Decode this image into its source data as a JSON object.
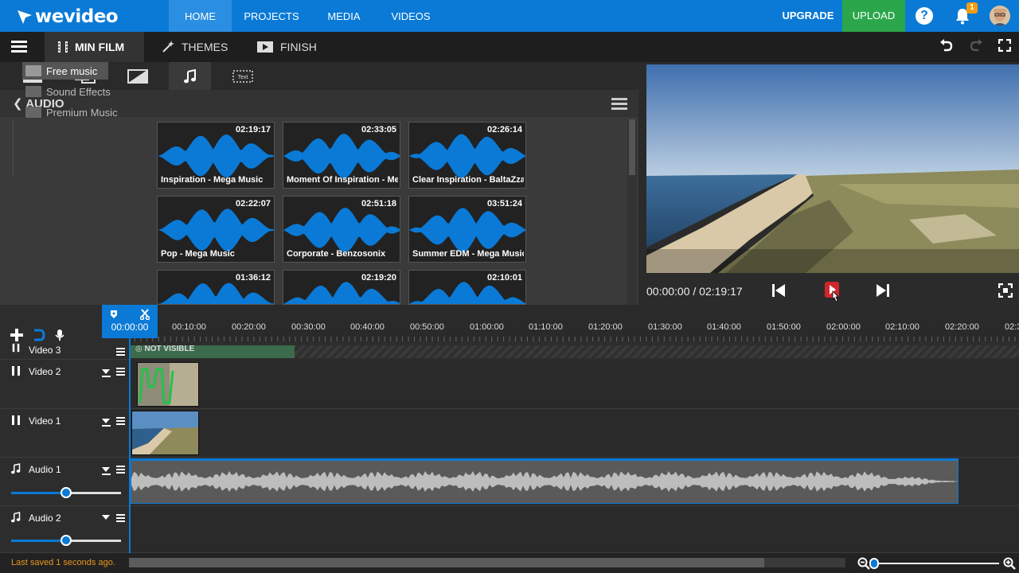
{
  "app": {
    "brand": "wevideo"
  },
  "colors": {
    "accent": "#0a7ad6",
    "upload": "#2ca64a",
    "badge": "#f39c12",
    "saved": "#e8961e",
    "waveform": "#0a7ad6"
  },
  "topnav": {
    "items": [
      "HOME",
      "PROJECTS",
      "MEDIA",
      "VIDEOS"
    ],
    "active": "HOME",
    "upgrade": "UPGRADE",
    "upload": "UPLOAD",
    "help": "?",
    "notifications": "1"
  },
  "editor": {
    "project_tab": "MIN FILM",
    "themes_tab": "THEMES",
    "finish_tab": "FINISH"
  },
  "media": {
    "tab_icons": [
      "media-icon",
      "transitions-icon",
      "color-icon",
      "music-icon",
      "text-icon"
    ],
    "active_tab": "music-icon",
    "text_tab_label": "Text",
    "section": "AUDIO",
    "folders": [
      "Free music",
      "Sound Effects",
      "Premium Music"
    ],
    "selected_folder": "Free music",
    "tracks": [
      {
        "title": "Inspiration - Mega Music",
        "duration": "02:19:17"
      },
      {
        "title": "Moment Of Inspiration - Me...",
        "duration": "02:33:05"
      },
      {
        "title": "Clear Inspiration - BaltaZzar",
        "duration": "02:26:14"
      },
      {
        "title": "Pop - Mega Music",
        "duration": "02:22:07"
      },
      {
        "title": "Corporate - Benzosonix",
        "duration": "02:51:18"
      },
      {
        "title": "Summer EDM - Mega Music",
        "duration": "03:51:24"
      },
      {
        "title": "",
        "duration": "01:36:12"
      },
      {
        "title": "",
        "duration": "02:19:20"
      },
      {
        "title": "",
        "duration": "02:10:01"
      }
    ]
  },
  "preview": {
    "timecode": "00:00:00 / 02:19:17"
  },
  "timeline": {
    "playhead": "00:00:00",
    "ticks": [
      "00:10:00",
      "00:20:00",
      "00:30:00",
      "00:40:00",
      "00:50:00",
      "01:00:00",
      "01:10:00",
      "01:20:00",
      "01:30:00",
      "01:40:00",
      "01:50:00",
      "02:00:00",
      "02:10:00",
      "02:20:00",
      "02:3"
    ],
    "tracks": [
      {
        "name": "Video 3",
        "type": "video"
      },
      {
        "name": "Video 2",
        "type": "video"
      },
      {
        "name": "Video 1",
        "type": "video"
      },
      {
        "name": "Audio 1",
        "type": "audio",
        "volume": 0.5
      },
      {
        "name": "Audio 2",
        "type": "audio",
        "volume": 0.5
      }
    ],
    "video3_label": "NOT VISIBLE"
  },
  "status": {
    "last_saved": "Last saved 1 seconds ago."
  }
}
